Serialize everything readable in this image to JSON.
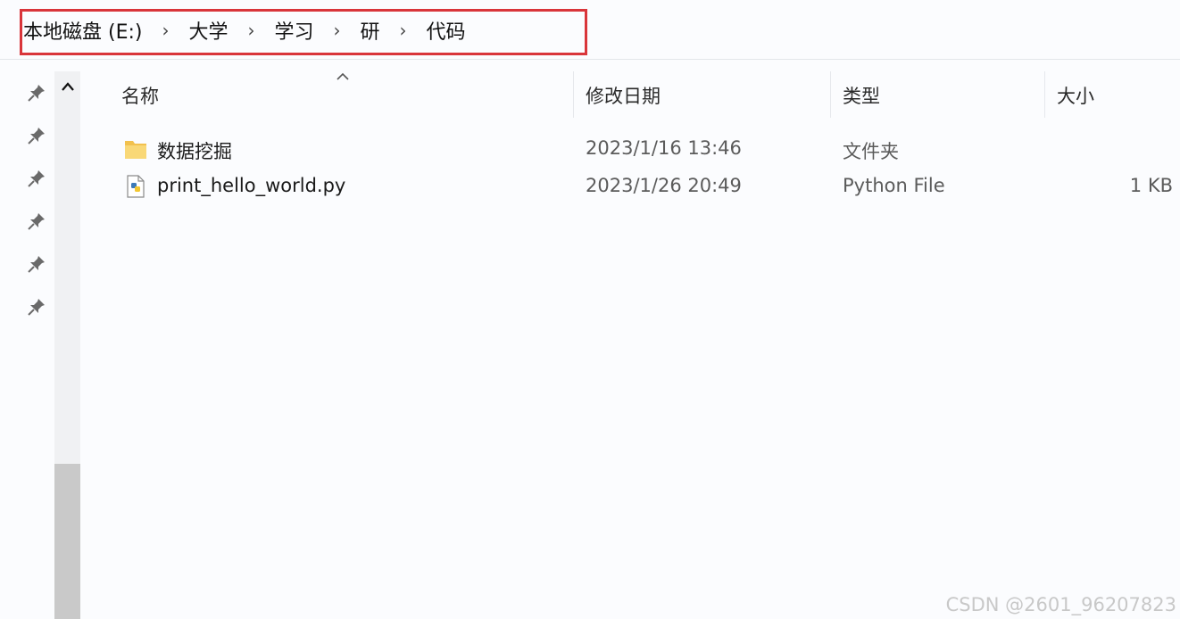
{
  "breadcrumb": {
    "items": [
      "本地磁盘 (E:)",
      "大学",
      "学习",
      "研",
      "代码"
    ],
    "separator": "›"
  },
  "columns": {
    "name": "名称",
    "modified": "修改日期",
    "type": "类型",
    "size": "大小"
  },
  "files": [
    {
      "name": "数据挖掘",
      "modified": "2023/1/16 13:46",
      "type": "文件夹",
      "size": "",
      "icon": "folder-icon"
    },
    {
      "name": "print_hello_world.py",
      "modified": "2023/1/26 20:49",
      "type": "Python File",
      "size": "1 KB",
      "icon": "python-file-icon"
    }
  ],
  "pinned_items": 6,
  "watermark": "CSDN @2601_96207823",
  "colors": {
    "highlight": "#d9353a",
    "folder": "#f6cf57",
    "background": "#fbfcfe"
  }
}
